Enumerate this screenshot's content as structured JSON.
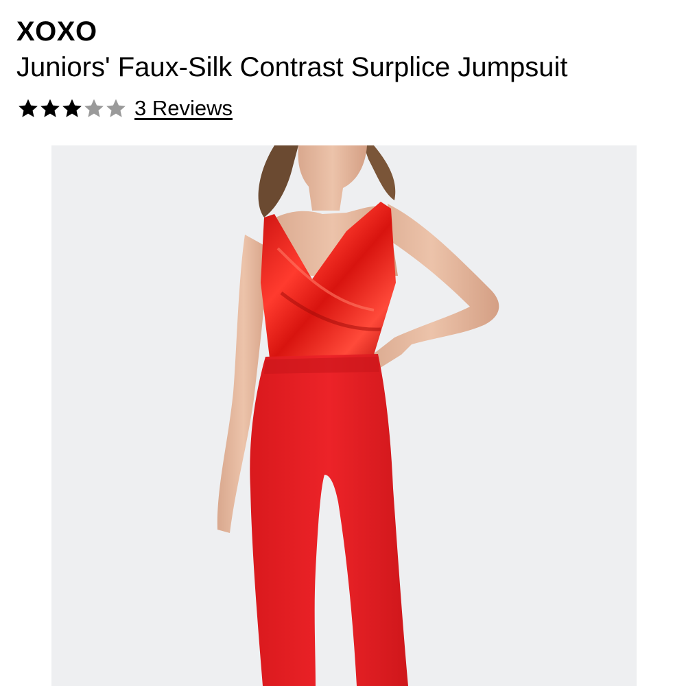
{
  "product": {
    "brand": "XOXO",
    "name": "Juniors' Faux-Silk Contrast Surplice Jumpsuit"
  },
  "rating": {
    "stars_filled": 3,
    "stars_total": 5,
    "reviews_label": "3 Reviews",
    "filled_color": "#000000",
    "empty_color": "#9a9a9a"
  },
  "image": {
    "subject": "model wearing red jumpsuit",
    "background_color": "#eeeff1",
    "garment_color": "#e01e22"
  }
}
